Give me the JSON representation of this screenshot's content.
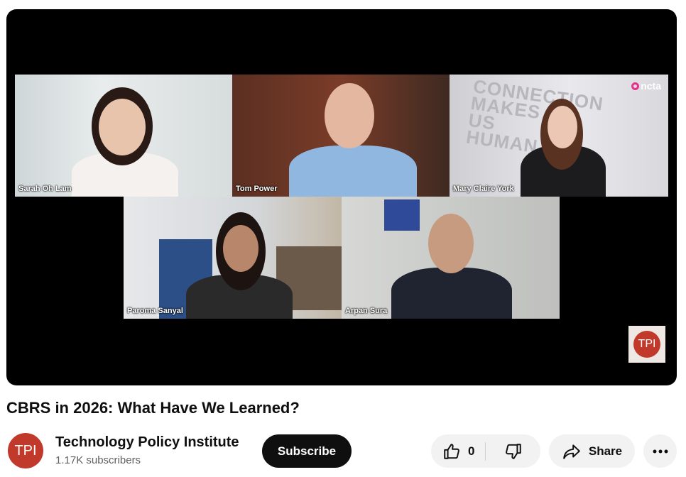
{
  "video": {
    "title": "CBRS in 2026: What Have We Learned?",
    "participants": [
      {
        "name": "Sarah Oh Lam"
      },
      {
        "name": "Tom Power"
      },
      {
        "name": "Mary Claire York"
      },
      {
        "name": "Paroma Sanyal"
      },
      {
        "name": "Arpan Sura"
      }
    ],
    "wall_text": "CONNECTION MAKES US HUMAN",
    "ncta_logo": "ncta",
    "watermark": "TPI"
  },
  "channel": {
    "avatar_text": "TPI",
    "name": "Technology Policy Institute",
    "subscribers": "1.17K subscribers",
    "subscribe_label": "Subscribe"
  },
  "actions": {
    "like_count": "0",
    "share_label": "Share",
    "icons": [
      "thumbs-up-icon",
      "thumbs-down-icon",
      "share-icon",
      "more-icon"
    ]
  },
  "colors": {
    "brand_red": "#c0392b",
    "pill_bg": "#f2f2f2",
    "text_primary": "#0f0f0f",
    "text_secondary": "#606060"
  }
}
